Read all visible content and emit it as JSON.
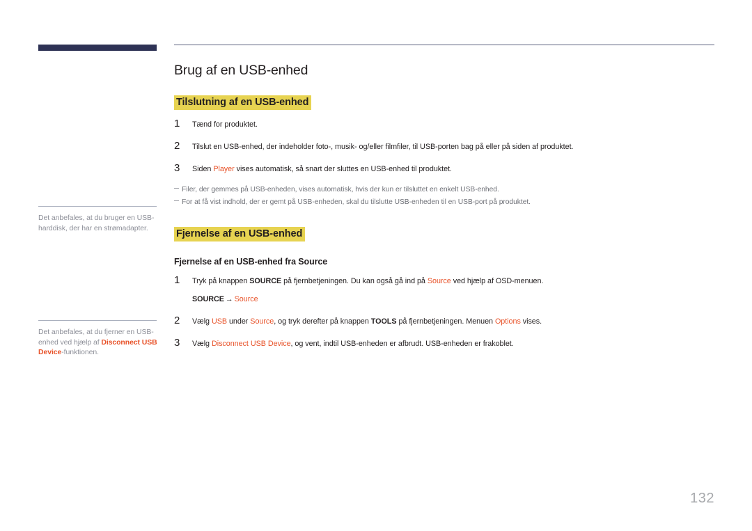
{
  "document": {
    "page_number": "132",
    "accent_color": "#e8532a",
    "highlight_color": "#e7d351",
    "sidebar_bar_color": "#2e3255"
  },
  "sidebar": {
    "notes": [
      {
        "parts": [
          {
            "text": "Det anbefales, at du bruger en USB-harddisk, der har en strømadapter.",
            "style": "normal"
          }
        ],
        "plain": "Det anbefales, at du bruger en USB-harddisk, der har en strømadapter."
      },
      {
        "parts": [
          {
            "text": "Det anbefales, at du fjerner en USB-enhed ved hjælp af ",
            "style": "normal"
          },
          {
            "text": "Disconnect USB Device",
            "style": "accent-bold"
          },
          {
            "text": "-funktionen.",
            "style": "normal"
          }
        ],
        "plain": "Det anbefales, at du fjerner en USB-enhed ved hjælp af Disconnect USB Device-funktionen."
      }
    ]
  },
  "main": {
    "title": "Brug af en USB-enhed",
    "section_1": {
      "heading": "Tilslutning af en USB-enhed",
      "steps": [
        {
          "number": "1",
          "parts": [
            {
              "text": "Tænd for produktet.",
              "style": "normal"
            }
          ],
          "plain": "Tænd for produktet."
        },
        {
          "number": "2",
          "parts": [
            {
              "text": "Tilslut en USB-enhed, der indeholder foto-, musik- og/eller filmfiler, til USB-porten bag på eller på siden af produktet.",
              "style": "normal"
            }
          ],
          "plain": "Tilslut en USB-enhed, der indeholder foto-, musik- og/eller filmfiler, til USB-porten bag på eller på siden af produktet."
        },
        {
          "number": "3",
          "parts": [
            {
              "text": "Siden ",
              "style": "normal"
            },
            {
              "text": "Player",
              "style": "accent"
            },
            {
              "text": " vises automatisk, så snart der sluttes en USB-enhed til produktet.",
              "style": "normal"
            }
          ],
          "plain": "Siden Player vises automatisk, så snart der sluttes en USB-enhed til produktet."
        }
      ],
      "notes": [
        "Filer, der gemmes på USB-enheden, vises automatisk, hvis der kun er tilsluttet en enkelt USB-enhed.",
        "For at få vist indhold, der er gemt på USB-enheden, skal du tilslutte USB-enheden til en USB-port på produktet."
      ]
    },
    "section_2": {
      "heading": "Fjernelse af en USB-enhed",
      "sub_heading": "Fjernelse af en USB-enhed fra Source",
      "steps": [
        {
          "number": "1",
          "parts": [
            {
              "text": "Tryk på knappen ",
              "style": "normal"
            },
            {
              "text": "SOURCE",
              "style": "bold"
            },
            {
              "text": " på fjernbetjeningen. Du kan også gå ind på ",
              "style": "normal"
            },
            {
              "text": "Source",
              "style": "accent"
            },
            {
              "text": " ved hjælp af OSD-menuen.",
              "style": "normal"
            }
          ],
          "plain": "Tryk på knappen SOURCE på fjernbetjeningen. Du kan også gå ind på Source ved hjælp af OSD-menuen.",
          "path": {
            "key": "SOURCE",
            "arrow": "→",
            "target": "Source"
          }
        },
        {
          "number": "2",
          "parts": [
            {
              "text": "Vælg ",
              "style": "normal"
            },
            {
              "text": "USB",
              "style": "accent"
            },
            {
              "text": " under ",
              "style": "normal"
            },
            {
              "text": "Source",
              "style": "accent"
            },
            {
              "text": ", og tryk derefter på knappen ",
              "style": "normal"
            },
            {
              "text": "TOOLS",
              "style": "bold"
            },
            {
              "text": " på fjernbetjeningen. Menuen ",
              "style": "normal"
            },
            {
              "text": "Options",
              "style": "accent"
            },
            {
              "text": " vises.",
              "style": "normal"
            }
          ],
          "plain": "Vælg USB under Source, og tryk derefter på knappen TOOLS på fjernbetjeningen. Menuen Options vises."
        },
        {
          "number": "3",
          "parts": [
            {
              "text": "Vælg ",
              "style": "normal"
            },
            {
              "text": "Disconnect USB Device",
              "style": "accent"
            },
            {
              "text": ", og vent, indtil USB-enheden er afbrudt. USB-enheden er frakoblet.",
              "style": "normal"
            }
          ],
          "plain": "Vælg Disconnect USB Device, og vent, indtil USB-enheden er afbrudt. USB-enheden er frakoblet."
        }
      ]
    }
  }
}
